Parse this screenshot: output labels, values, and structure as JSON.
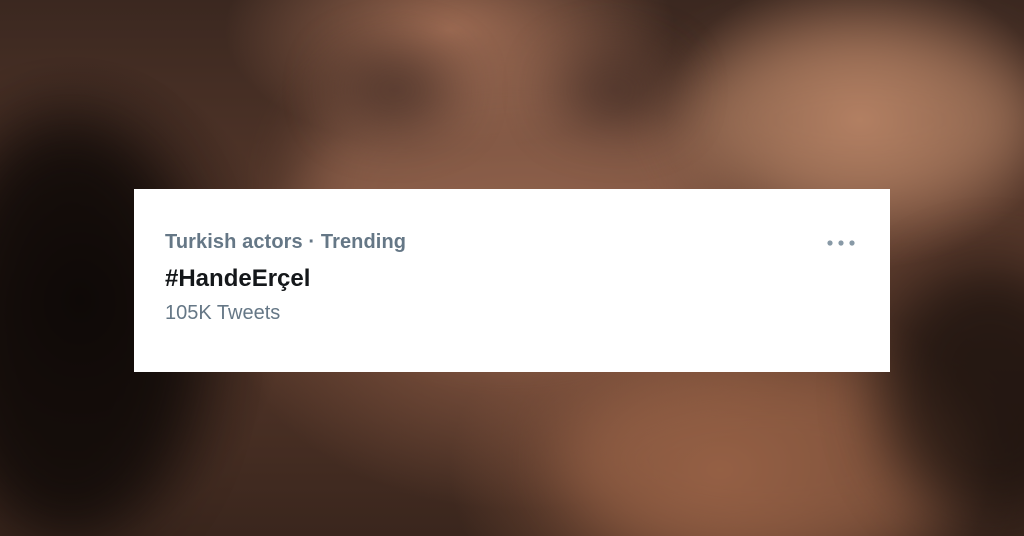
{
  "background": {
    "description_icon": "blurred-photo",
    "tone_color": "#6b4535"
  },
  "trend_card": {
    "category": "Turkish actors",
    "separator": "·",
    "status": "Trending",
    "hashtag": "#HandeErçel",
    "tweet_count": "105K Tweets",
    "more_icon": "more-horizontal-icon",
    "accent_color": "#657786",
    "text_color": "#14171a"
  }
}
